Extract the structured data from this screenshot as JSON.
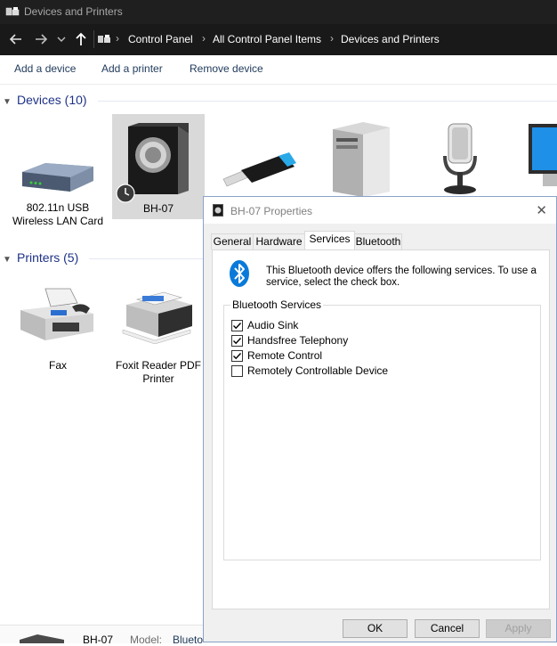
{
  "window": {
    "title": "Devices and Printers"
  },
  "address": {
    "crumbs": [
      "Control Panel",
      "All Control Panel Items",
      "Devices and Printers"
    ]
  },
  "commands": {
    "add_device": "Add a device",
    "add_printer": "Add a printer",
    "remove_device": "Remove device"
  },
  "groups": {
    "devices_header": "Devices (10)",
    "printers_header": "Printers (5)"
  },
  "devices": [
    {
      "label": "802.11n USB Wireless LAN Card",
      "icon": "wifi-adapter-icon"
    },
    {
      "label": "BH-07",
      "icon": "speaker-icon",
      "selected": true
    },
    {
      "label": "",
      "icon": "usb-drive-icon"
    },
    {
      "label": "",
      "icon": "computer-tower-icon"
    },
    {
      "label": "",
      "icon": "microphone-icon"
    },
    {
      "label": "",
      "icon": "monitor-icon"
    }
  ],
  "printers": [
    {
      "label": "Fax",
      "icon": "fax-icon"
    },
    {
      "label": "Foxit Reader PDF Printer",
      "icon": "printer-icon"
    }
  ],
  "statusbar": {
    "device_name": "BH-07",
    "model_label": "Model:",
    "model_value": "Blueto"
  },
  "dialog": {
    "title": "BH-07 Properties",
    "tabs": [
      "General",
      "Hardware",
      "Services",
      "Bluetooth"
    ],
    "active_tab": "Services",
    "description": "This Bluetooth device offers the following services. To use a service, select the check box.",
    "group_title": "Bluetooth Services",
    "services": [
      {
        "label": "Audio Sink",
        "checked": true
      },
      {
        "label": "Handsfree Telephony",
        "checked": true
      },
      {
        "label": "Remote Control",
        "checked": true
      },
      {
        "label": "Remotely Controllable Device",
        "checked": false
      }
    ],
    "buttons": {
      "ok": "OK",
      "cancel": "Cancel",
      "apply": "Apply"
    }
  },
  "colors": {
    "accent": "#0078d7",
    "link": "#1e395b",
    "group_header": "#1e3287"
  }
}
